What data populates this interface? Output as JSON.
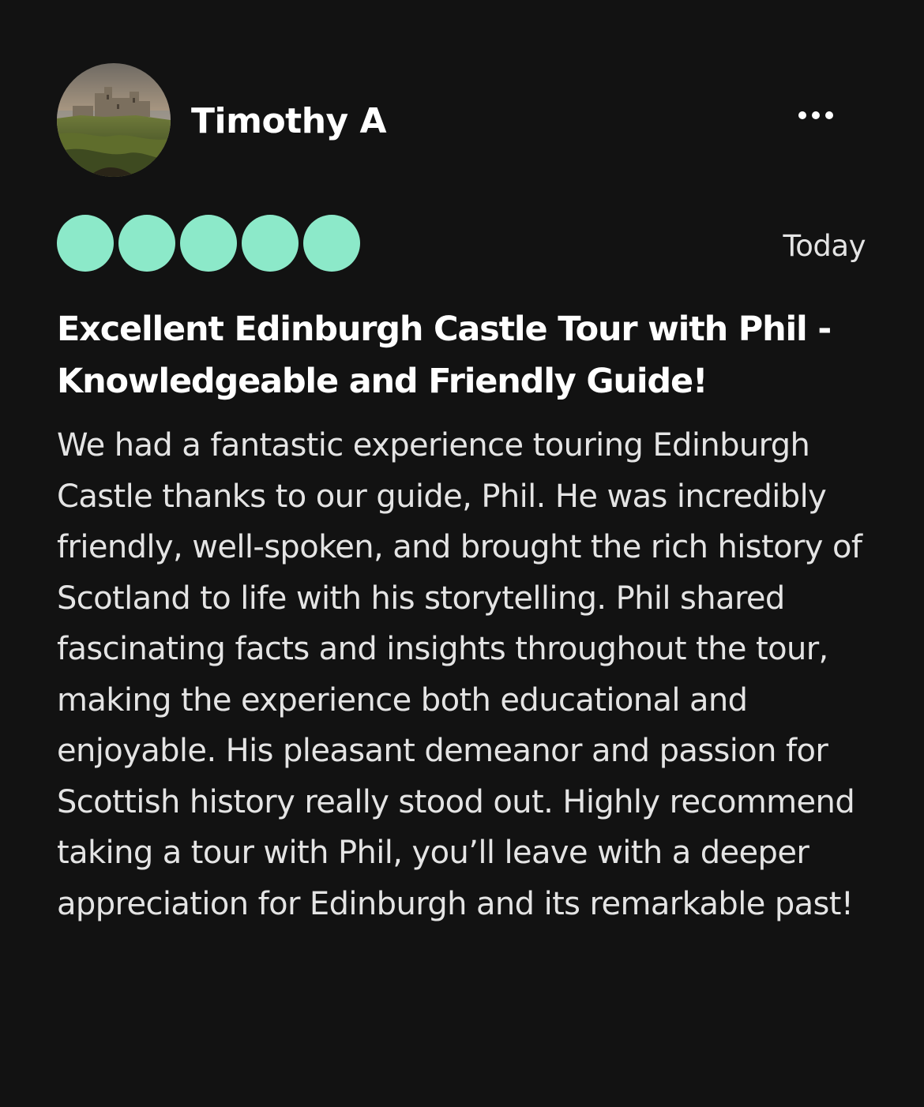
{
  "review": {
    "user_name": "Timothy A",
    "date": "Today",
    "rating": {
      "value": 5,
      "max": 5,
      "color": "#8ce9c9"
    },
    "title": "Excellent Edinburgh Castle Tour with Phil - Knowledgeable and Friendly Guide!",
    "body": "We had a fantastic experience touring Edinburgh Castle thanks to our guide, Phil. He was incredibly friendly, well-spoken, and brought the rich history of Scotland to life with his storytelling. Phil shared fascinating facts and insights throughout the tour, making the experience both educational and enjoyable. His pleasant demeanor and passion for Scottish history really stood out. Highly recommend taking a tour with Phil, you’ll leave with a deeper appreciation for Edinburgh and its remarkable past!"
  },
  "icons": {
    "more": "more-options-icon",
    "avatar": "castle-photo"
  },
  "colors": {
    "background": "#121212",
    "text_primary": "#ffffff",
    "text_secondary": "#e4e4e4",
    "rating_bubble": "#8ce9c9"
  }
}
